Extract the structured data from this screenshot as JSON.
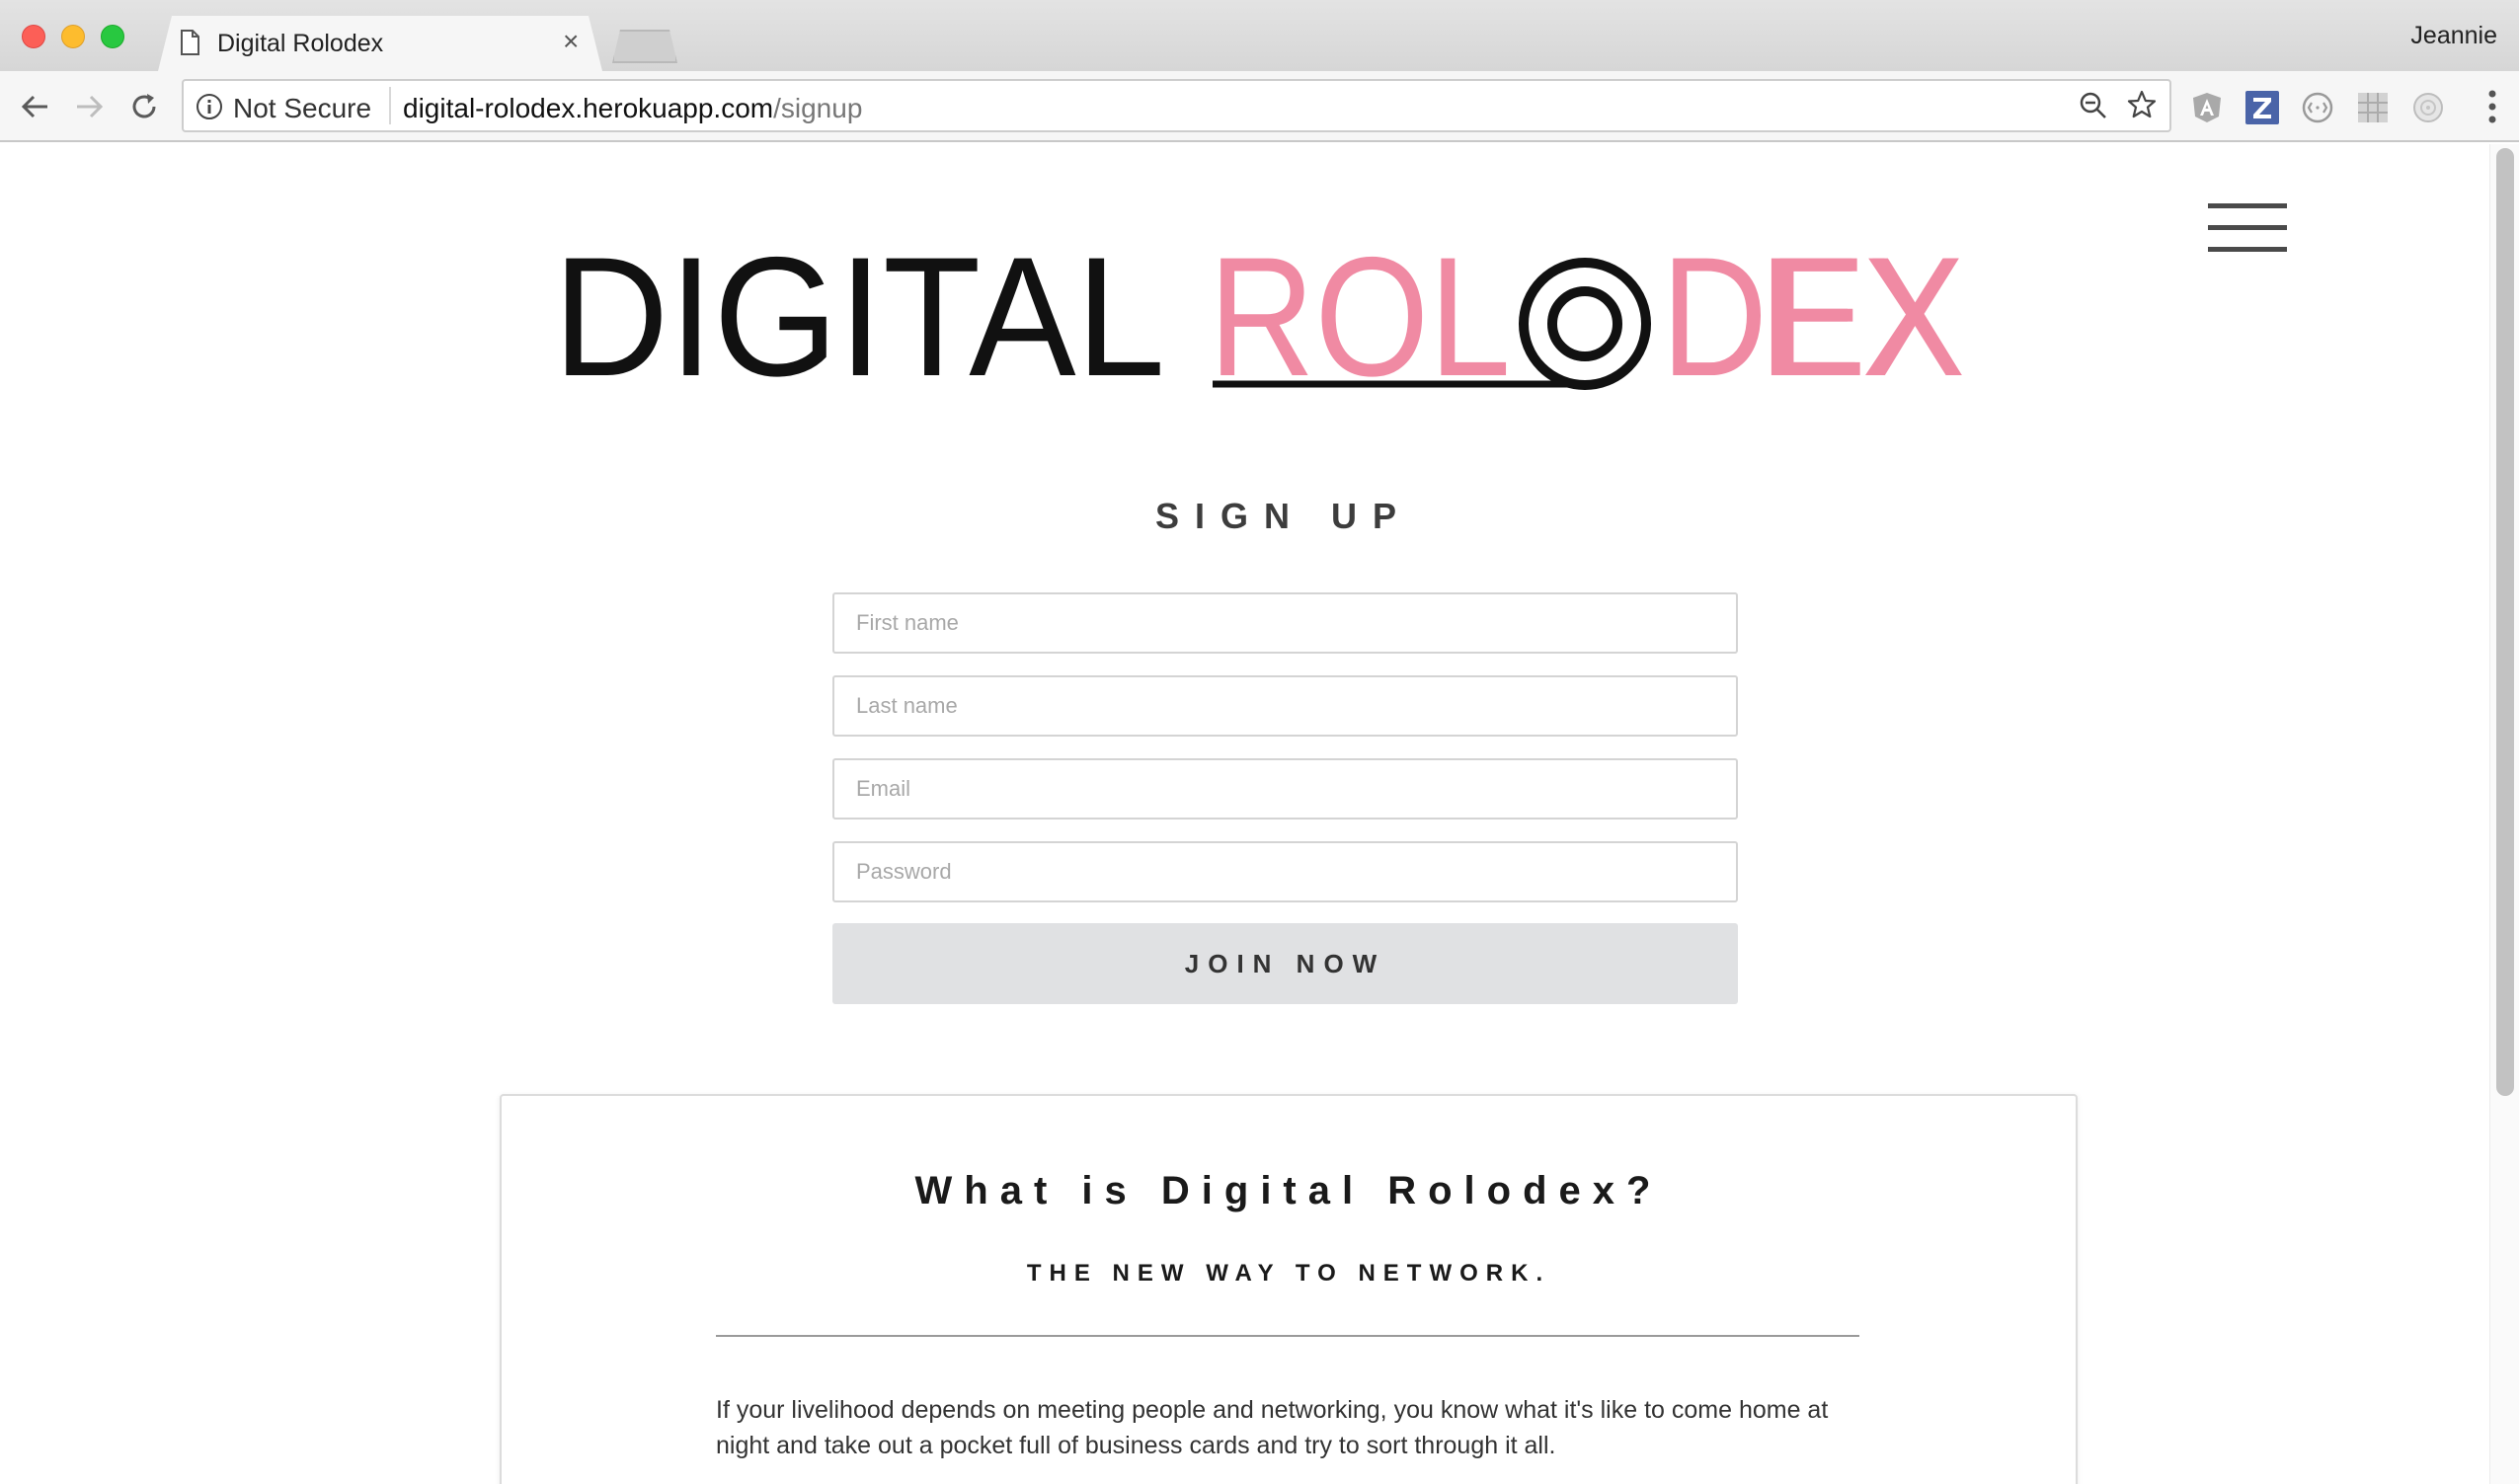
{
  "browser": {
    "tab_title": "Digital Rolodex",
    "tab_close": "×",
    "profile_name": "Jeannie",
    "security_label": "Not Secure",
    "url_host": "digital-rolodex.herokuapp.com",
    "url_path": "/signup",
    "extensions": [
      "angular-icon",
      "zotero-icon",
      "cors-icon",
      "grid-extension-icon",
      "react-extension-icon"
    ],
    "colors": {
      "close": "#fc5f57",
      "minimize": "#fdbc2e",
      "maximize": "#28c840"
    }
  },
  "header": {
    "logo_text_dark": "DIGITAL",
    "logo_text_accent": "ROLODEX",
    "logo_accent_color": "#f08aa3"
  },
  "signup": {
    "title": "SIGN UP",
    "first_name_placeholder": "First name",
    "last_name_placeholder": "Last name",
    "email_placeholder": "Email",
    "password_placeholder": "Password",
    "join_label": "JOIN NOW"
  },
  "about": {
    "title": "What is Digital Rolodex?",
    "subtitle": "THE NEW WAY TO NETWORK.",
    "body": "If your livelihood depends on meeting people and networking, you know what it's like to come home at night and take out a pocket full of business cards and try to sort through it all."
  }
}
